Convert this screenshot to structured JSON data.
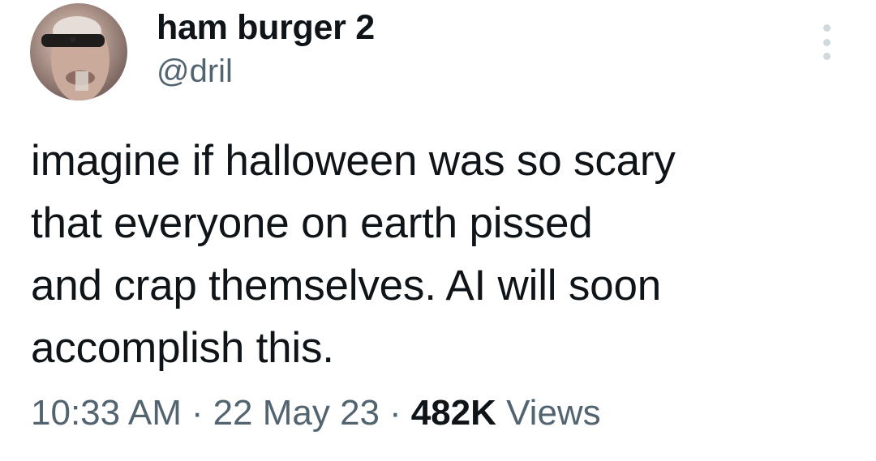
{
  "author": {
    "display_name": "ham burger 2",
    "handle": "@dril"
  },
  "more_icon": "more-vertical-icon",
  "tweet": {
    "lines": [
      "imagine if halloween was so scary",
      "that everyone on earth pissed",
      "and crap themselves. AI will soon",
      "accomplish this."
    ]
  },
  "meta": {
    "time": "10:33 AM",
    "separator": "·",
    "date": "22 May 23",
    "views_count": "482K",
    "views_label": "Views"
  },
  "colors": {
    "text_primary": "#0f1419",
    "text_secondary": "#536471",
    "dots": "#cfd9de"
  }
}
